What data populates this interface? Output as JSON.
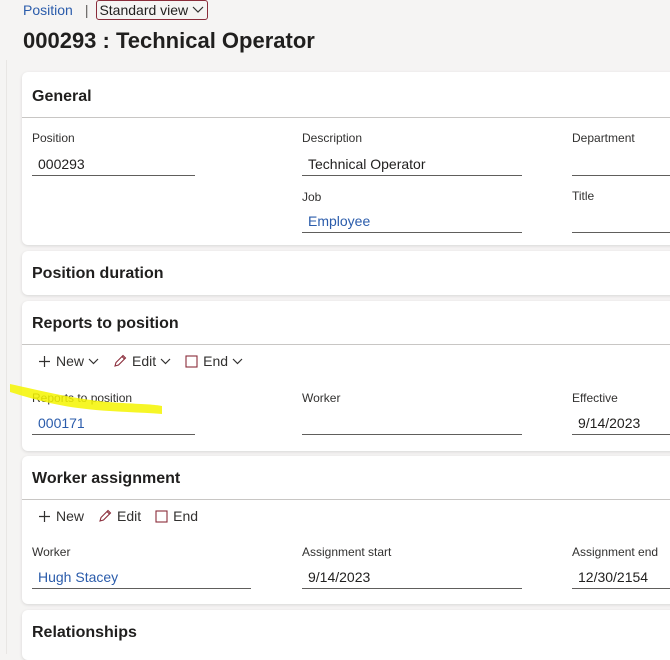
{
  "breadcrumb": {
    "position": "Position",
    "view": "Standard view"
  },
  "page_title": "000293 : Technical Operator",
  "general": {
    "header": "General",
    "position_label": "Position",
    "position_value": "000293",
    "description_label": "Description",
    "description_value": "Technical Operator",
    "department_label": "Department",
    "department_value": "",
    "job_label": "Job",
    "job_value": "Employee",
    "title_label": "Title",
    "title_value": ""
  },
  "position_duration": {
    "header": "Position duration"
  },
  "reports_to": {
    "header": "Reports to position",
    "toolbar": {
      "new": "New",
      "edit": "Edit",
      "end": "End"
    },
    "reports_label": "Reports to position",
    "reports_value": "000171",
    "worker_label": "Worker",
    "worker_value": "",
    "effective_label": "Effective",
    "effective_value": "9/14/2023"
  },
  "worker_assignment": {
    "header": "Worker assignment",
    "toolbar": {
      "new": "New",
      "edit": "Edit",
      "end": "End"
    },
    "worker_label": "Worker",
    "worker_value": "Hugh Stacey",
    "start_label": "Assignment start",
    "start_value": "9/14/2023",
    "end_label": "Assignment end",
    "end_value": "12/30/2154"
  },
  "relationships": {
    "header": "Relationships"
  },
  "colors": {
    "link": "#2b5cab",
    "accent": "#8a2c3a",
    "highlight": "#f5f500"
  }
}
